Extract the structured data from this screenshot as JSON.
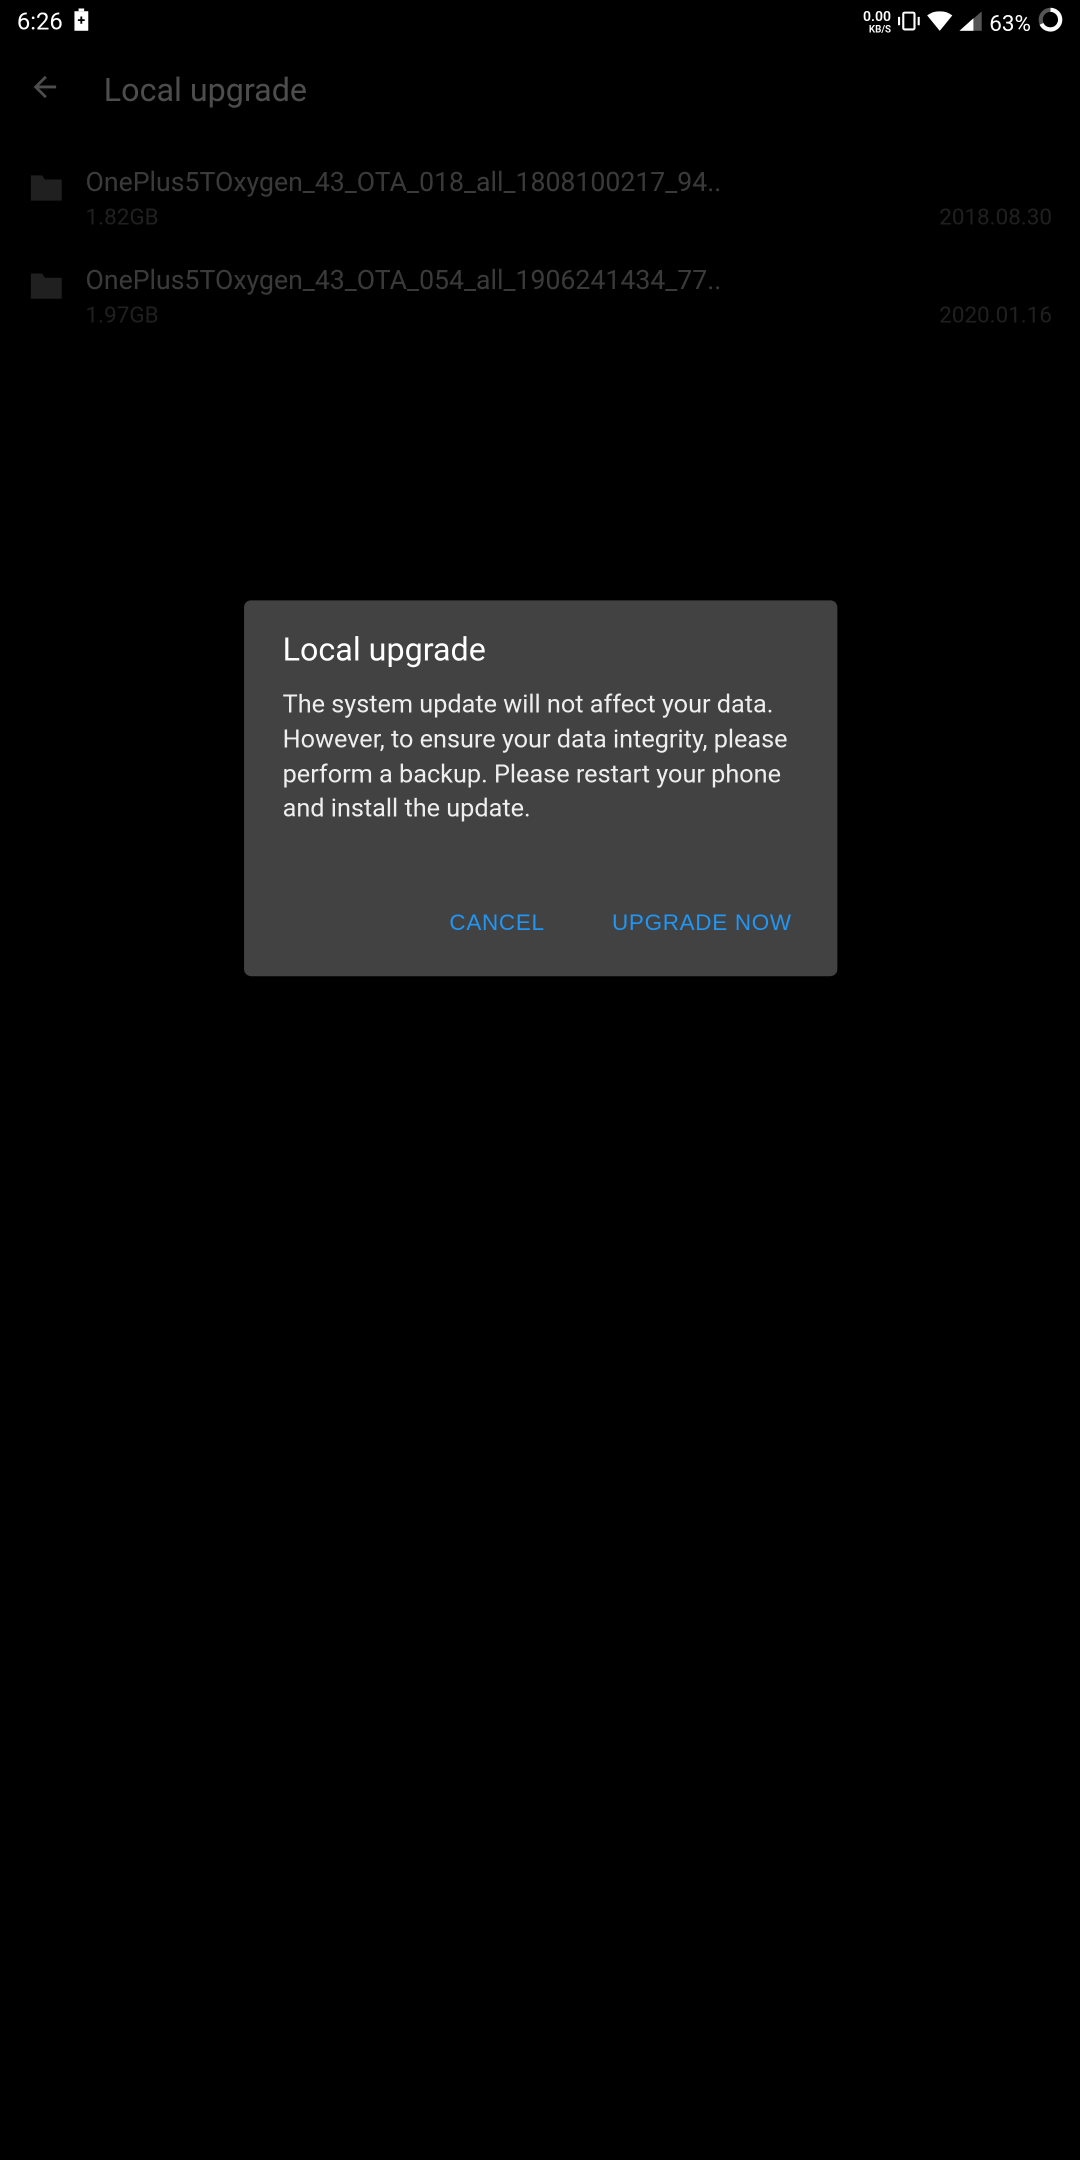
{
  "status_bar": {
    "time": "6:26",
    "data_speed": "0.00",
    "data_unit": "KB/S",
    "battery_pct": "63%"
  },
  "header": {
    "title": "Local upgrade"
  },
  "files": [
    {
      "name": "OnePlus5TOxygen_43_OTA_018_all_1808100217_94..",
      "size": "1.82GB",
      "date": "2018.08.30"
    },
    {
      "name": "OnePlus5TOxygen_43_OTA_054_all_1906241434_77..",
      "size": "1.97GB",
      "date": "2020.01.16"
    }
  ],
  "dialog": {
    "title": "Local upgrade",
    "message": "The system update will not affect your data.\nHowever, to ensure your data integrity, please perform a backup. Please restart your phone and install the update.",
    "cancel_label": "CANCEL",
    "confirm_label": "UPGRADE NOW"
  }
}
